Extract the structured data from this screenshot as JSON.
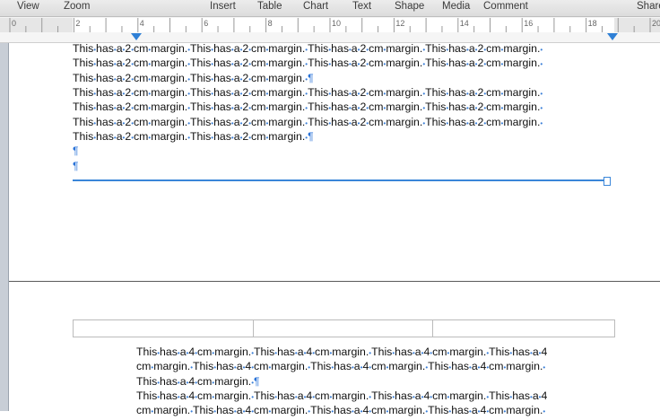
{
  "toolbar": {
    "view": "View",
    "zoom": "Zoom",
    "insert": "Insert",
    "table": "Table",
    "chart": "Chart",
    "text": "Text",
    "shape": "Shape",
    "media": "Media",
    "comment": "Comment",
    "share": "Share"
  },
  "ruler": {
    "numbers": [
      "0",
      "2",
      "4",
      "6",
      "8",
      "10",
      "12",
      "14",
      "16",
      "18",
      "20"
    ]
  },
  "page1": {
    "text": "This has a 2 cm margin.",
    "pilcrow": "¶"
  },
  "page2": {
    "text": "This has a 4 cm margin."
  },
  "colors": {
    "accent": "#3a86d9",
    "invisibles": "#2a73d8"
  }
}
